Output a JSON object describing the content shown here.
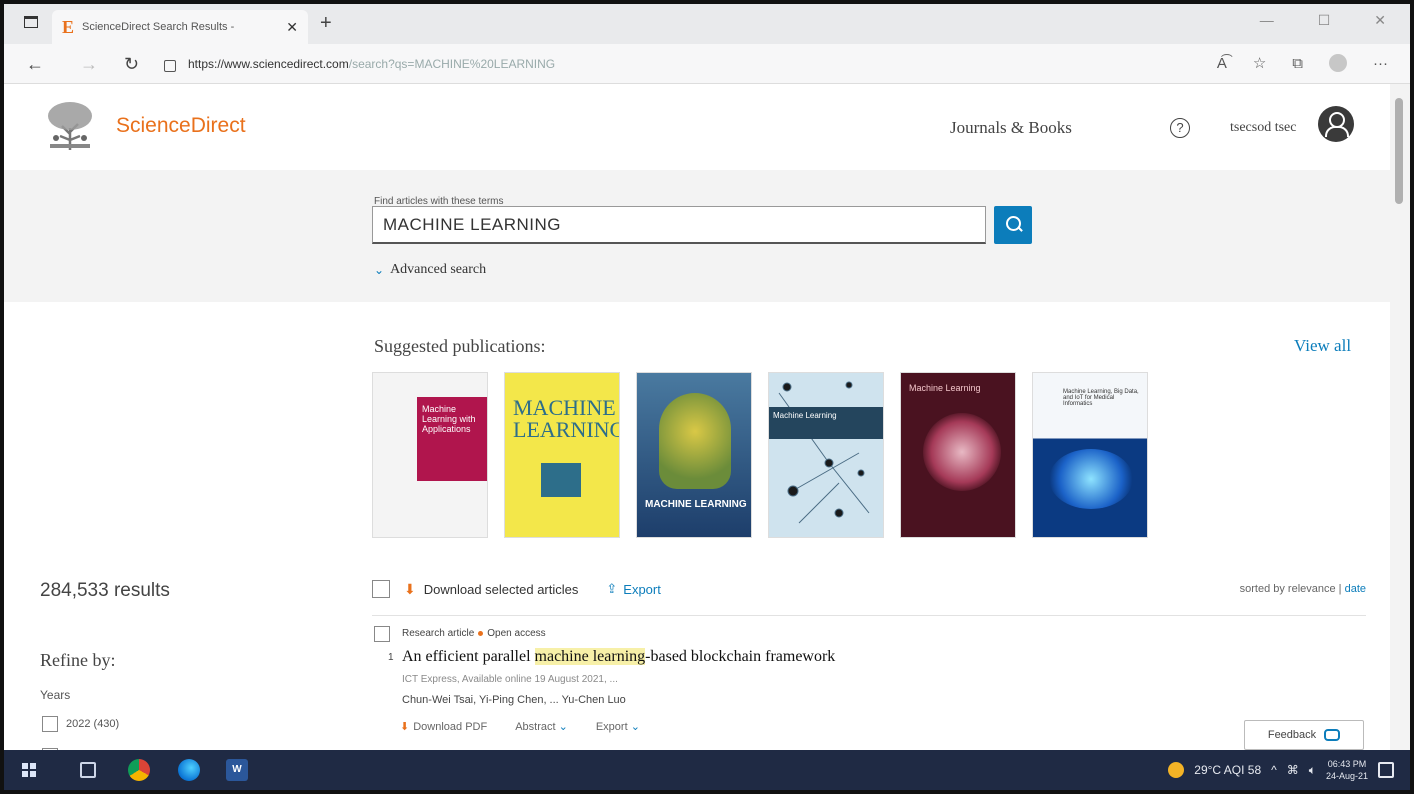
{
  "browser": {
    "tab_title": "ScienceDirect Search Results - ",
    "tab_favicon": "E",
    "url_host": "https://www.sciencedirect.com",
    "url_path": "/search?qs=MACHINE%20LEARNING"
  },
  "header": {
    "brand": "ScienceDirect",
    "journals_link": "Journals & Books",
    "help_glyph": "?",
    "username": "tsecsod tsec"
  },
  "search": {
    "label": "Find articles with these terms",
    "value": "MACHINE LEARNING",
    "advanced": "Advanced search"
  },
  "suggested": {
    "title": "Suggested publications:",
    "view_all": "View all",
    "covers": [
      {
        "text": "Machine Learning with Applications"
      },
      {
        "text": "MACHINE LEARNING"
      },
      {
        "text": "MACHINE LEARNING"
      },
      {
        "text": "Machine Learning"
      },
      {
        "text": "Machine Learning"
      },
      {
        "text": "Machine Learning, Big Data, and IoT for Medical Informatics"
      }
    ]
  },
  "results": {
    "count": "284,533 results",
    "download_selected": "Download selected articles",
    "export": "Export",
    "sort_prefix": "sorted by relevance | ",
    "sort_date": "date"
  },
  "refine": {
    "title": "Refine by:",
    "years_label": "Years",
    "year_items": [
      "2022 (430)"
    ]
  },
  "article": {
    "type": "Research article",
    "access": "Open access",
    "number": "1",
    "title_pre": "An efficient parallel ",
    "title_hl": "machine learning",
    "title_post": "-based blockchain framework",
    "source": "ICT Express, Available online 19 August 2021, ...",
    "authors": "Chun-Wei Tsai, Yi-Ping Chen, ... Yu-Chen Luo",
    "download_pdf": "Download PDF",
    "abstract": "Abstract",
    "export": "Export"
  },
  "feedback": "Feedback",
  "taskbar": {
    "weather": "29°C AQI 58",
    "time": "06:43 PM",
    "date": "24-Aug-21",
    "word_glyph": "W"
  },
  "colors": {
    "brand_orange": "#e9711c",
    "link_blue": "#0c7dbb",
    "taskbar": "#1f2a44"
  }
}
